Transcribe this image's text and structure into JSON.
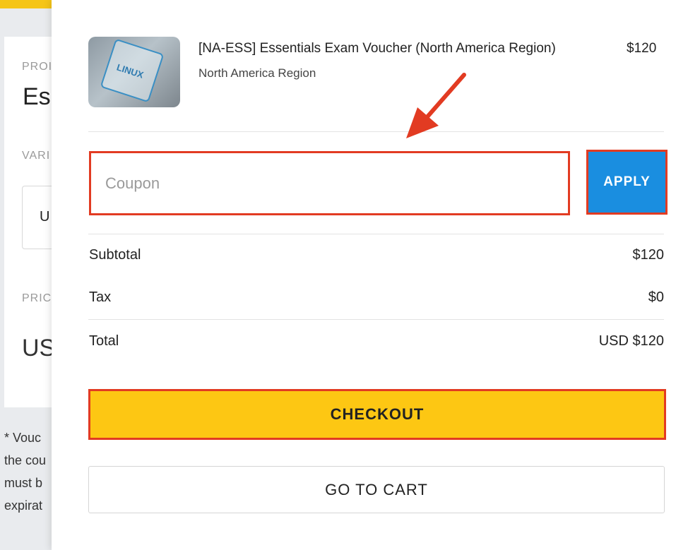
{
  "background": {
    "labels": [
      "PROI",
      "VARI",
      "PRIC"
    ],
    "product_name": "Es",
    "variant_value": "U",
    "price": "US",
    "note_lines": [
      "* Vouc",
      "the cou",
      "must b",
      "expirat"
    ]
  },
  "cart_item": {
    "title": "[NA-ESS] Essentials Exam Voucher (North America Region)",
    "price": "$120",
    "variant": "North America Region",
    "thumbnail_text": "LINUX"
  },
  "coupon": {
    "placeholder": "Coupon",
    "value": "",
    "apply_label": "APPLY"
  },
  "summary": {
    "subtotal_label": "Subtotal",
    "subtotal_value": "$120",
    "tax_label": "Tax",
    "tax_value": "$0",
    "total_label": "Total",
    "total_value": "USD $120"
  },
  "actions": {
    "checkout_label": "CHECKOUT",
    "cart_label": "GO TO CART"
  },
  "colors": {
    "accent_yellow": "#fdc713",
    "apply_blue": "#1a8ee0",
    "highlight_red": "#e23b22"
  }
}
